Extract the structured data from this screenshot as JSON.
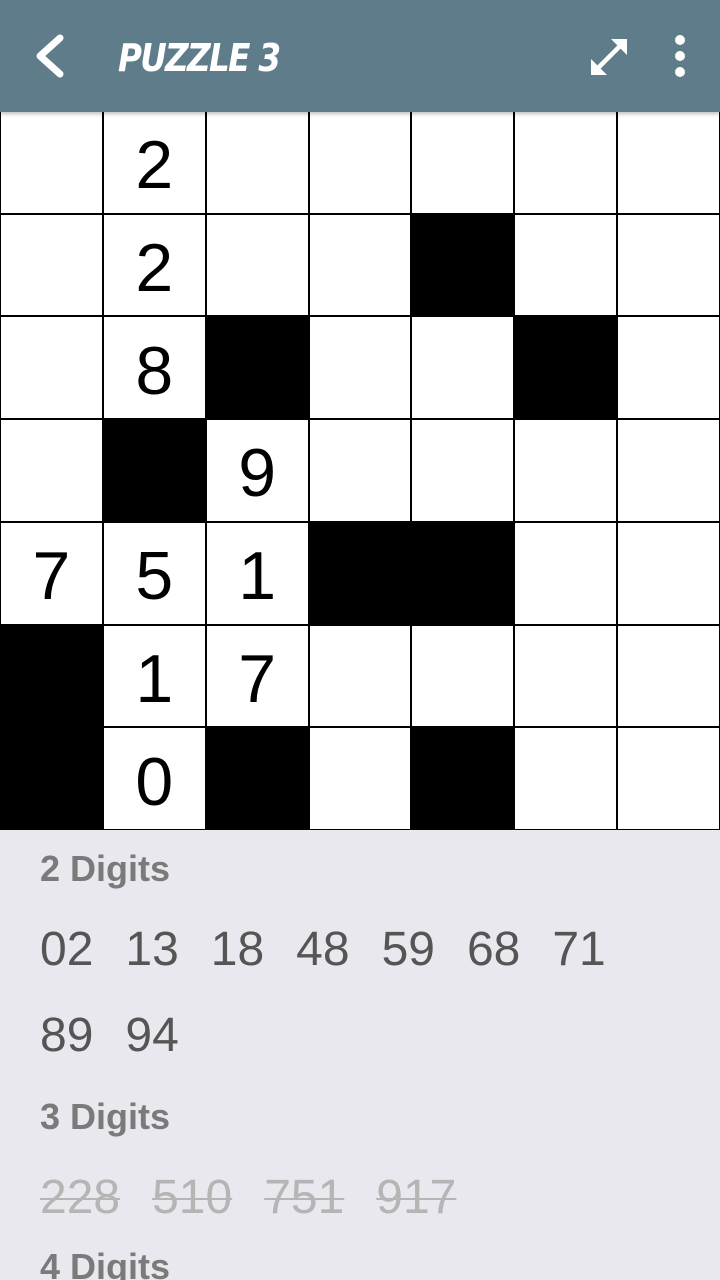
{
  "header": {
    "title": "PUZZLE 3",
    "back_icon": "chevron-left-icon",
    "expand_icon": "expand-arrows-icon",
    "more_icon": "more-vertical-icon",
    "bg_color": "#5f7c8a"
  },
  "grid": {
    "size": 7,
    "rows": [
      [
        "",
        "2",
        "",
        "",
        "",
        "",
        ""
      ],
      [
        "",
        "2",
        "",
        "",
        "#",
        "",
        ""
      ],
      [
        "",
        "8",
        "#",
        "",
        "",
        "#",
        ""
      ],
      [
        "",
        "#",
        "9",
        "",
        "",
        "",
        ""
      ],
      [
        "7",
        "5",
        "1",
        "#",
        "#",
        "",
        ""
      ],
      [
        "#",
        "1",
        "7",
        "",
        "",
        "",
        ""
      ],
      [
        "#",
        "0",
        "#",
        "",
        "#",
        "",
        ""
      ]
    ]
  },
  "clues": {
    "two_digits": {
      "heading": "2 Digits",
      "items": [
        "02",
        "13",
        "18",
        "48",
        "59",
        "68",
        "71",
        "89",
        "94"
      ]
    },
    "three_digits": {
      "heading": "3 Digits",
      "items": [
        "228",
        "510",
        "751",
        "917"
      ],
      "used": [
        true,
        true,
        true,
        true
      ]
    },
    "four_digits": {
      "heading": "4 Digits"
    }
  }
}
